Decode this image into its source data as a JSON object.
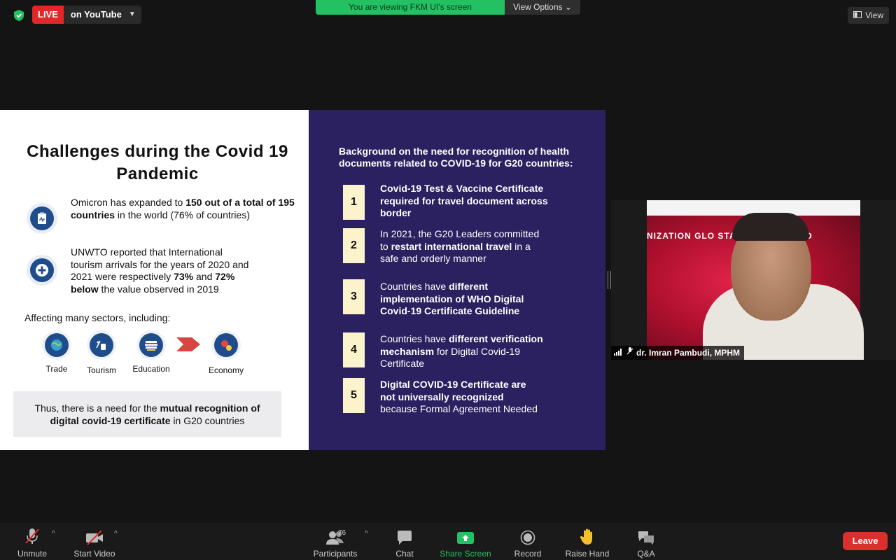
{
  "top_bar": {
    "live_badge": "LIVE",
    "live_target": "on YouTube",
    "viewing_banner": "You are viewing FKM UI's screen",
    "view_options": "View Options",
    "view_button": "View"
  },
  "slide": {
    "left": {
      "title": "Challenges during the Covid 19 Pandemic",
      "bullet1": {
        "t1": "Omicron has expanded to ",
        "b1": "150 out of a total of 195 countries",
        "t2": " in the world (76% of countries)"
      },
      "bullet2": {
        "t1": "UNWTO reported that International tourism arrivals for the years of 2020 and 2021 were respectively ",
        "b1": "73%",
        "t2": " and ",
        "b2": "72% below",
        "t3": " the value observed in 2019"
      },
      "sectors_label": "Affecting many sectors, including:",
      "sectors": [
        "Trade",
        "Tourism",
        "Education",
        "Economy"
      ],
      "conclusion": {
        "t1": "Thus, there is a need for the ",
        "b1": "mutual recognition of digital covid-19 certificate",
        "t2": "  in G20 countries"
      }
    },
    "right": {
      "heading": "Background on the need for recognition of health documents related to COVID-19 for G20 countries:",
      "items": [
        {
          "num": "1",
          "t1": "",
          "b1": "Covid-19 Test & Vaccine Certificate required for travel document across border",
          "t2": ""
        },
        {
          "num": "2",
          "t1": "In 2021, the G20 Leaders committed to ",
          "b1": "restart international travel",
          "t2": " in a safe and orderly manner"
        },
        {
          "num": "3",
          "t1": "Countries have ",
          "b1": "different implementation of WHO Digital Covid-19 Certificate Guideline",
          "t2": ""
        },
        {
          "num": "4",
          "t1": "Countries have ",
          "b1": "different verification mechanism",
          "t2": " for Digital Covid-19 Certificate"
        },
        {
          "num": "5",
          "t1": "",
          "b1": "Digital COVID-19 Certificate are not universally recognized",
          "t2": " because Formal Agreement Needed"
        }
      ]
    }
  },
  "video": {
    "participant_name": "dr. Imran Pambudi, MPHM",
    "background_text": "NIZATION GLO      STANDARDS PROTO"
  },
  "toolbar": {
    "unmute": "Unmute",
    "start_video": "Start Video",
    "participants": "Participants",
    "participants_count": "76",
    "chat": "Chat",
    "share_screen": "Share Screen",
    "record": "Record",
    "raise_hand": "Raise Hand",
    "qa": "Q&A",
    "leave": "Leave"
  },
  "colors": {
    "live_red": "#e02828",
    "share_green": "#23c064",
    "leave_red": "#d9302b",
    "slide_purple": "#2b2060",
    "number_box": "#fbf3cc"
  }
}
